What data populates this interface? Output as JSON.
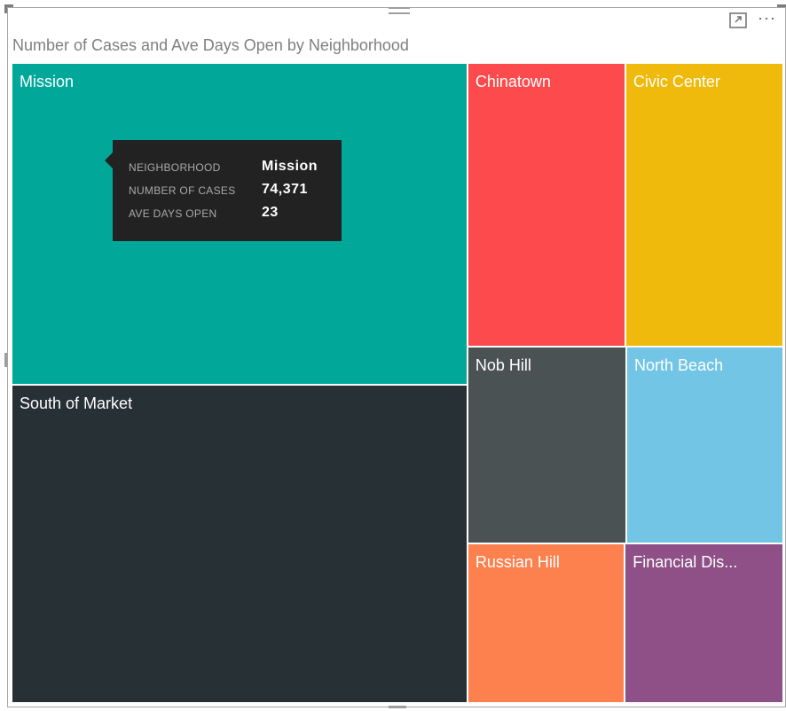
{
  "header": {
    "title": "Number of Cases and Ave Days Open by Neighborhood",
    "more_label": "···"
  },
  "tooltip": {
    "rows": [
      {
        "key": "NEIGHBORHOOD",
        "value": "Mission"
      },
      {
        "key": "NUMBER OF CASES",
        "value": "74,371"
      },
      {
        "key": "AVE DAYS OPEN",
        "value": "23"
      }
    ]
  },
  "chart_data": {
    "type": "treemap",
    "title": "Number of Cases and Ave Days Open by Neighborhood",
    "measure": "Number of Cases",
    "items": [
      {
        "name": "Mission",
        "label": "Mission",
        "value": 74371,
        "ave_days_open": 23,
        "color": "#01A89A"
      },
      {
        "name": "South of Market",
        "label": "South of Market",
        "value": 73500,
        "color": "#263035"
      },
      {
        "name": "Chinatown",
        "label": "Chinatown",
        "value": 22700,
        "color": "#FD4B4D"
      },
      {
        "name": "Civic Center",
        "label": "Civic Center",
        "value": 22700,
        "color": "#F0BA0C"
      },
      {
        "name": "Nob Hill",
        "label": "Nob Hill",
        "value": 15900,
        "color": "#4B5254"
      },
      {
        "name": "North Beach",
        "label": "North Beach",
        "value": 15700,
        "color": "#72C5E5"
      },
      {
        "name": "Russian Hill",
        "label": "Russian Hill",
        "value": 12700,
        "color": "#FC814F"
      },
      {
        "name": "Financial District",
        "label": "Financial Dis...",
        "value": 12800,
        "color": "#8E5087"
      }
    ]
  }
}
